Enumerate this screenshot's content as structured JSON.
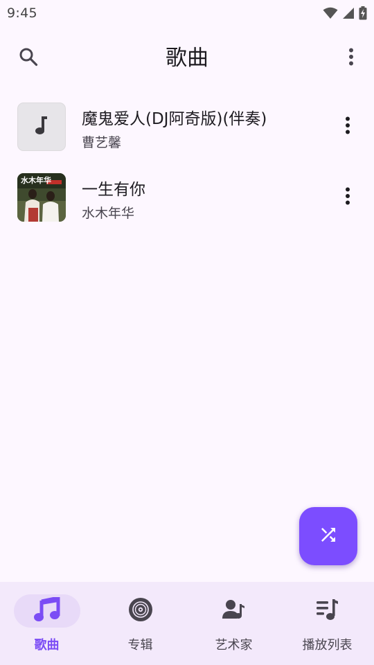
{
  "status_bar": {
    "time": "9:45",
    "icons": [
      "wifi-icon",
      "signal-icon",
      "battery-charging-icon"
    ]
  },
  "header": {
    "title": "歌曲",
    "left_icon": "search-icon",
    "right_icon": "more-vert-icon"
  },
  "songs": [
    {
      "title": "魔鬼爱人(DJ阿奇版)(伴奏)",
      "artist": "曹艺馨",
      "cover": "music-note-placeholder",
      "menu_icon": "more-vert-icon"
    },
    {
      "title": "一生有你",
      "artist": "水木年华",
      "cover": "album-art-photo",
      "menu_icon": "more-vert-icon"
    }
  ],
  "fab": {
    "icon": "shuffle-icon",
    "color": "#7c4dff"
  },
  "bottom_nav": {
    "items": [
      {
        "label": "歌曲",
        "icon": "music-note-icon",
        "active": true
      },
      {
        "label": "专辑",
        "icon": "album-disc-icon",
        "active": false
      },
      {
        "label": "艺术家",
        "icon": "artist-icon",
        "active": false
      },
      {
        "label": "播放列表",
        "icon": "playlist-icon",
        "active": false
      }
    ]
  },
  "colors": {
    "background": "#fdf7ff",
    "accent": "#7b4cf5",
    "nav_background": "#f3e9fb",
    "active_pill": "#e8daf8"
  }
}
